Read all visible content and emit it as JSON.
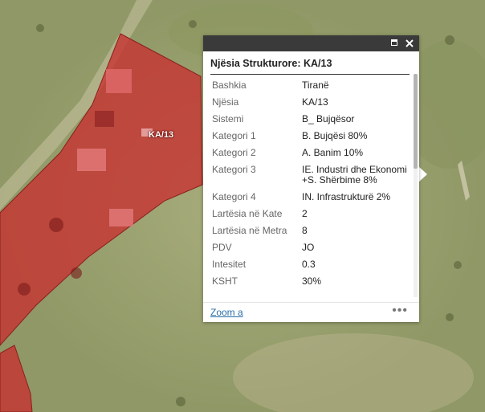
{
  "map": {
    "parcel_label": "KA/13",
    "parcel_color": "#c83030",
    "field_color": "#9aa372"
  },
  "popup": {
    "title": "Njësia Strukturore: KA/13",
    "rows": [
      {
        "key": "Bashkia",
        "value": "Tiranë"
      },
      {
        "key": "Njësia",
        "value": "KA/13"
      },
      {
        "key": "Sistemi",
        "value": "B_ Bujqësor"
      },
      {
        "key": "Kategori 1",
        "value": "B. Bujqësi 80%"
      },
      {
        "key": "Kategori 2",
        "value": "A. Banim 10%"
      },
      {
        "key": "Kategori 3",
        "value": "IE. Industri dhe Ekonomi +S. Shërbime 8%"
      },
      {
        "key": "Kategori 4",
        "value": "IN. Infrastrukturë 2%"
      },
      {
        "key": "Lartësia në Kate",
        "value": "2"
      },
      {
        "key": "Lartësia në Metra",
        "value": "8"
      },
      {
        "key": "PDV",
        "value": "JO"
      },
      {
        "key": "Intesitet",
        "value": "0.3"
      },
      {
        "key": "KSHT",
        "value": "30%"
      }
    ],
    "zoom_label": "Zoom a",
    "more_label": "•••",
    "maximize_icon": "maximize-icon",
    "close_icon": "close-icon"
  }
}
